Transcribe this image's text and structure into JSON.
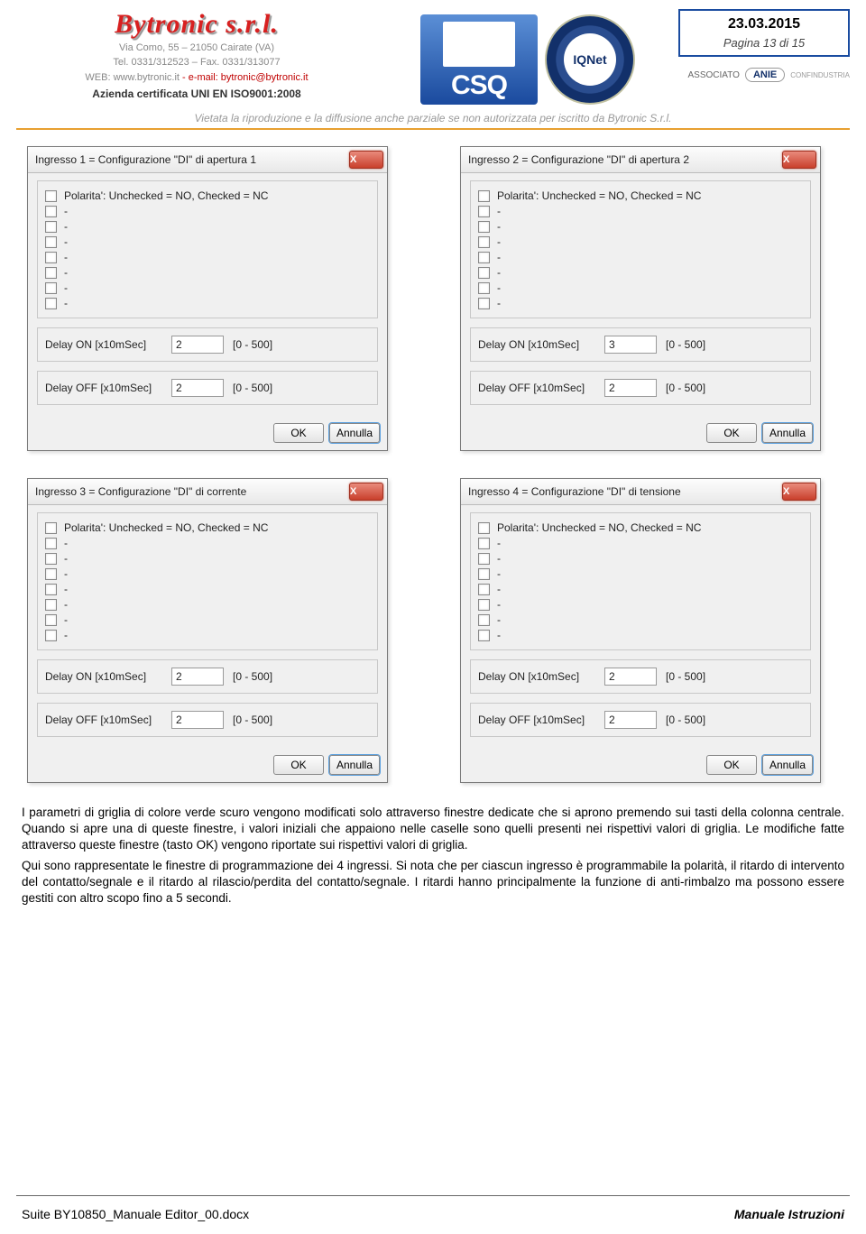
{
  "header": {
    "logo": "Bytronic s.r.l.",
    "addr1": "Via Como, 55 – 21050 Cairate (VA)",
    "addr2": "Tel. 0331/312523 – Fax. 0331/313077",
    "web_label": "WEB: ",
    "web": "www.bytronic.it",
    "em_sep": " - e-mail: ",
    "email": "bytronic@bytronic.it",
    "cert": "Azienda certificata UNI EN ISO9001:2008",
    "copyright": "Vietata la riproduzione e la diffusione anche parziale se non autorizzata per iscritto da Bytronic S.r.l.",
    "date": "23.03.2015",
    "page": "Pagina 13 di 15",
    "assoc_label": "ASSOCIATO",
    "anie": "ANIE",
    "confind": "CONFINDUSTRIA",
    "csq": "CSQ",
    "iqnet": "IQNet"
  },
  "common": {
    "polarity": "Polarita': Unchecked = NO, Checked = NC",
    "dash": "-",
    "delay_on": "Delay ON [x10mSec]",
    "delay_off": "Delay OFF [x10mSec]",
    "range": "[0 - 500]",
    "ok": "OK",
    "cancel": "Annulla",
    "close": "X"
  },
  "dialogs": [
    {
      "title": "Ingresso 1 = Configurazione \"DI\" di apertura 1",
      "delay_on": "2",
      "delay_off": "2"
    },
    {
      "title": "Ingresso 2 = Configurazione \"DI\" di apertura 2",
      "delay_on": "3",
      "delay_off": "2"
    },
    {
      "title": "Ingresso 3 = Configurazione \"DI\" di corrente",
      "delay_on": "2",
      "delay_off": "2"
    },
    {
      "title": "Ingresso 4 = Configurazione \"DI\" di tensione",
      "delay_on": "2",
      "delay_off": "2"
    }
  ],
  "body": {
    "p1": "I parametri di griglia di colore verde scuro vengono modificati solo attraverso finestre dedicate che si aprono premendo sui tasti della colonna centrale. Quando si apre una di queste finestre, i valori iniziali che appaiono nelle caselle sono quelli presenti nei rispettivi valori di griglia. Le modifiche fatte attraverso queste finestre (tasto OK) vengono riportate sui rispettivi valori di griglia.",
    "p2": "Qui sono rappresentate le finestre di programmazione dei 4 ingressi. Si nota che per ciascun ingresso è programmabile la polarità, il ritardo di intervento del contatto/segnale e il ritardo al rilascio/perdita del contatto/segnale. I ritardi hanno principalmente la funzione di anti-rimbalzo ma possono essere gestiti con altro scopo fino a 5 secondi."
  },
  "footer": {
    "left": "Suite BY10850_Manuale Editor_00.docx",
    "right": "Manuale Istruzioni"
  }
}
